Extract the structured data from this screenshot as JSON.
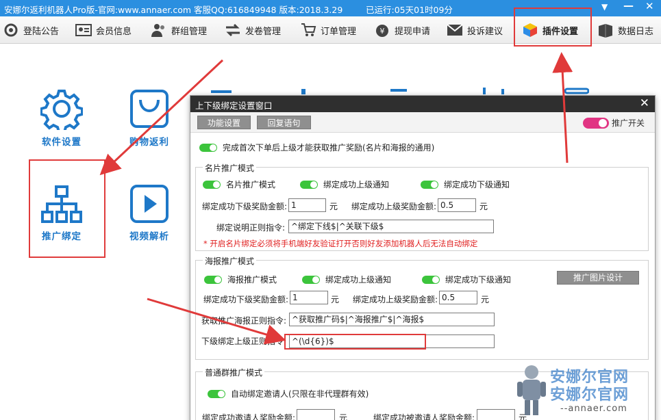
{
  "window": {
    "title": "安娜尔返利机器人Pro版-官网:www.annaer.com 客服QQ:616849948 版本:2018.3.29",
    "runtime": "已运行:05天01时09分"
  },
  "toolbar": [
    {
      "label": "登陆公告",
      "icon": "gear-announce-icon"
    },
    {
      "label": "会员信息",
      "icon": "id-card-icon"
    },
    {
      "label": "群组管理",
      "icon": "users-icon"
    },
    {
      "label": "发卷管理",
      "icon": "exchange-arrows-icon"
    },
    {
      "label": "订单管理",
      "icon": "cart-icon"
    },
    {
      "label": "提现申请",
      "icon": "money-bag-icon"
    },
    {
      "label": "投诉建议",
      "icon": "mail-icon"
    },
    {
      "label": "插件设置",
      "icon": "cube-icon"
    },
    {
      "label": "数据日志",
      "icon": "folder-icon"
    }
  ],
  "features": [
    {
      "label": "软件设置",
      "icon": "gear-icon"
    },
    {
      "label": "购物返利",
      "icon": "shopping-bag-icon"
    },
    {
      "label": "推广绑定",
      "icon": "org-chart-icon"
    },
    {
      "label": "视频解析",
      "icon": "play-icon"
    }
  ],
  "dialog": {
    "title": "上下级绑定设置窗口",
    "close": "✕",
    "tabs": [
      "功能设置",
      "回复语句"
    ],
    "master_toggle": "推广开关",
    "first_order_toggle": "完成首次下单后上级才能获取推广奖励(名片和海报的通用)",
    "card_group": {
      "title": "名片推广模式",
      "toggles": [
        "名片推广模式",
        "绑定成功上级通知",
        "绑定成功下级通知"
      ],
      "lower_reward_label": "绑定成功下级奖励金额:",
      "lower_reward_value": "1",
      "upper_reward_label": "绑定成功上级奖励金额:",
      "upper_reward_value": "0.5",
      "unit": "元",
      "regex_label": "绑定说明正则指令:",
      "regex_value": "^绑定下线$|^关联下级$",
      "warning": "* 开启名片绑定必须将手机端好友验证打开否则好友添加机器人后无法自动绑定"
    },
    "poster_group": {
      "title": "海报推广模式",
      "toggles": [
        "海报推广模式",
        "绑定成功上级通知",
        "绑定成功下级通知"
      ],
      "design_button": "推广图片设计",
      "lower_reward_label": "绑定成功下级奖励金额:",
      "lower_reward_value": "1",
      "upper_reward_label": "绑定成功上级奖励金额:",
      "upper_reward_value": "0.5",
      "unit": "元",
      "get_poster_label": "获取推广海报正则指令:",
      "get_poster_value": "^获取推广码$|^海报推广$|^海报$",
      "bind_upper_label": "下级绑定上级正则指令:",
      "bind_upper_value": "^(\\d{6})$"
    },
    "group_group": {
      "title": "普通群推广模式",
      "toggle": "自动绑定邀请人(只限在非代理群有效)",
      "inviter_reward_label": "绑定成功邀请人奖励金额:",
      "invitee_reward_label": "绑定成功被邀请人奖励金额:",
      "unit": "元"
    }
  },
  "watermark": {
    "line1": "安娜尔官网",
    "line2": "安娜尔官网",
    "url": "--annaer.com"
  },
  "colors": {
    "titlebar": "#2b8fe0",
    "accent_blue": "#1e78c8",
    "toggle_on": "#3cc43c",
    "toggle_master": "#e13583",
    "annotation_red": "#e03a3a"
  }
}
